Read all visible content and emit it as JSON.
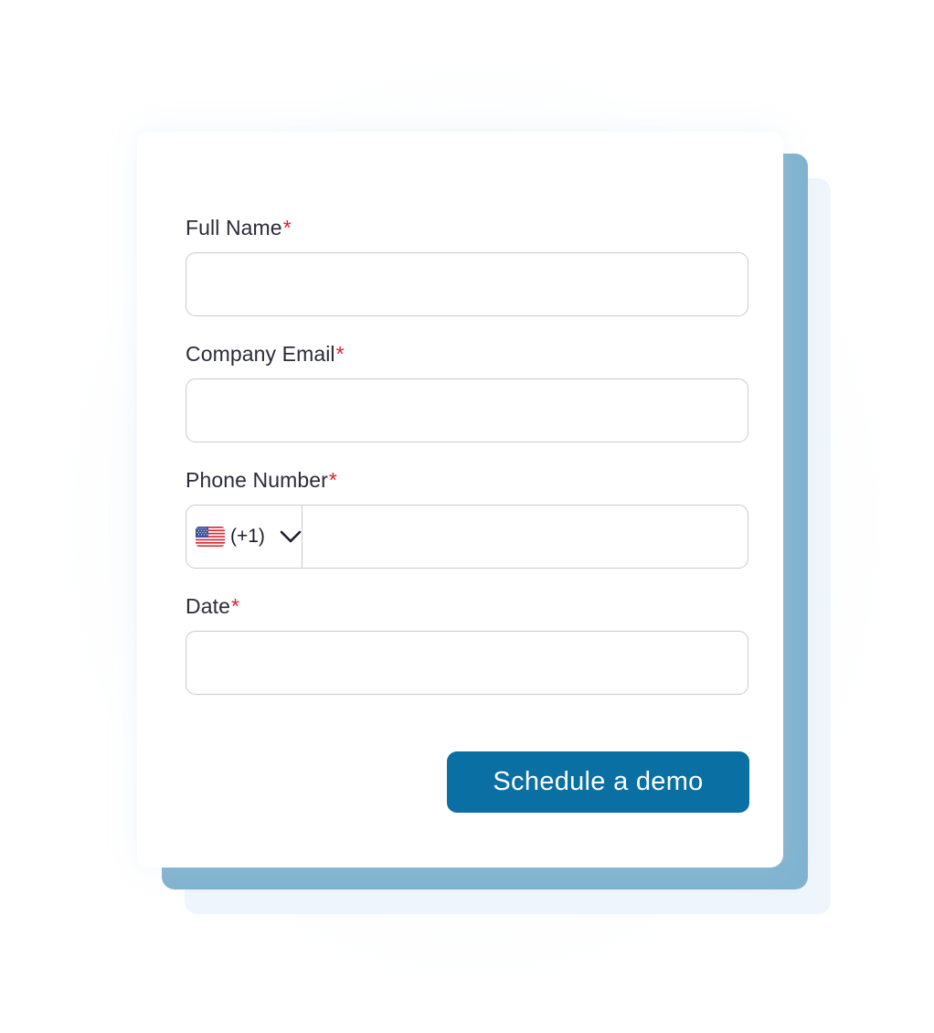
{
  "form": {
    "fields": [
      {
        "label": "Full Name",
        "required_mark": "*",
        "value": "",
        "placeholder": ""
      },
      {
        "label": "Company Email",
        "required_mark": "*",
        "value": "",
        "placeholder": ""
      },
      {
        "label": "Phone Number",
        "required_mark": "*",
        "value": "",
        "placeholder": ""
      },
      {
        "label": "Date",
        "required_mark": "*",
        "value": "",
        "placeholder": ""
      }
    ],
    "phone": {
      "country_flag_icon": "us-flag-icon",
      "dial_code": "(+1)",
      "dropdown_icon": "chevron-down-icon"
    },
    "submit_label": "Schedule a demo"
  },
  "colors": {
    "accent": "#0a6fa3",
    "back_panel": "#7fb3cf",
    "required": "#e01e2f",
    "label_text": "#2b2b3a",
    "input_border": "#c9c9d3"
  }
}
